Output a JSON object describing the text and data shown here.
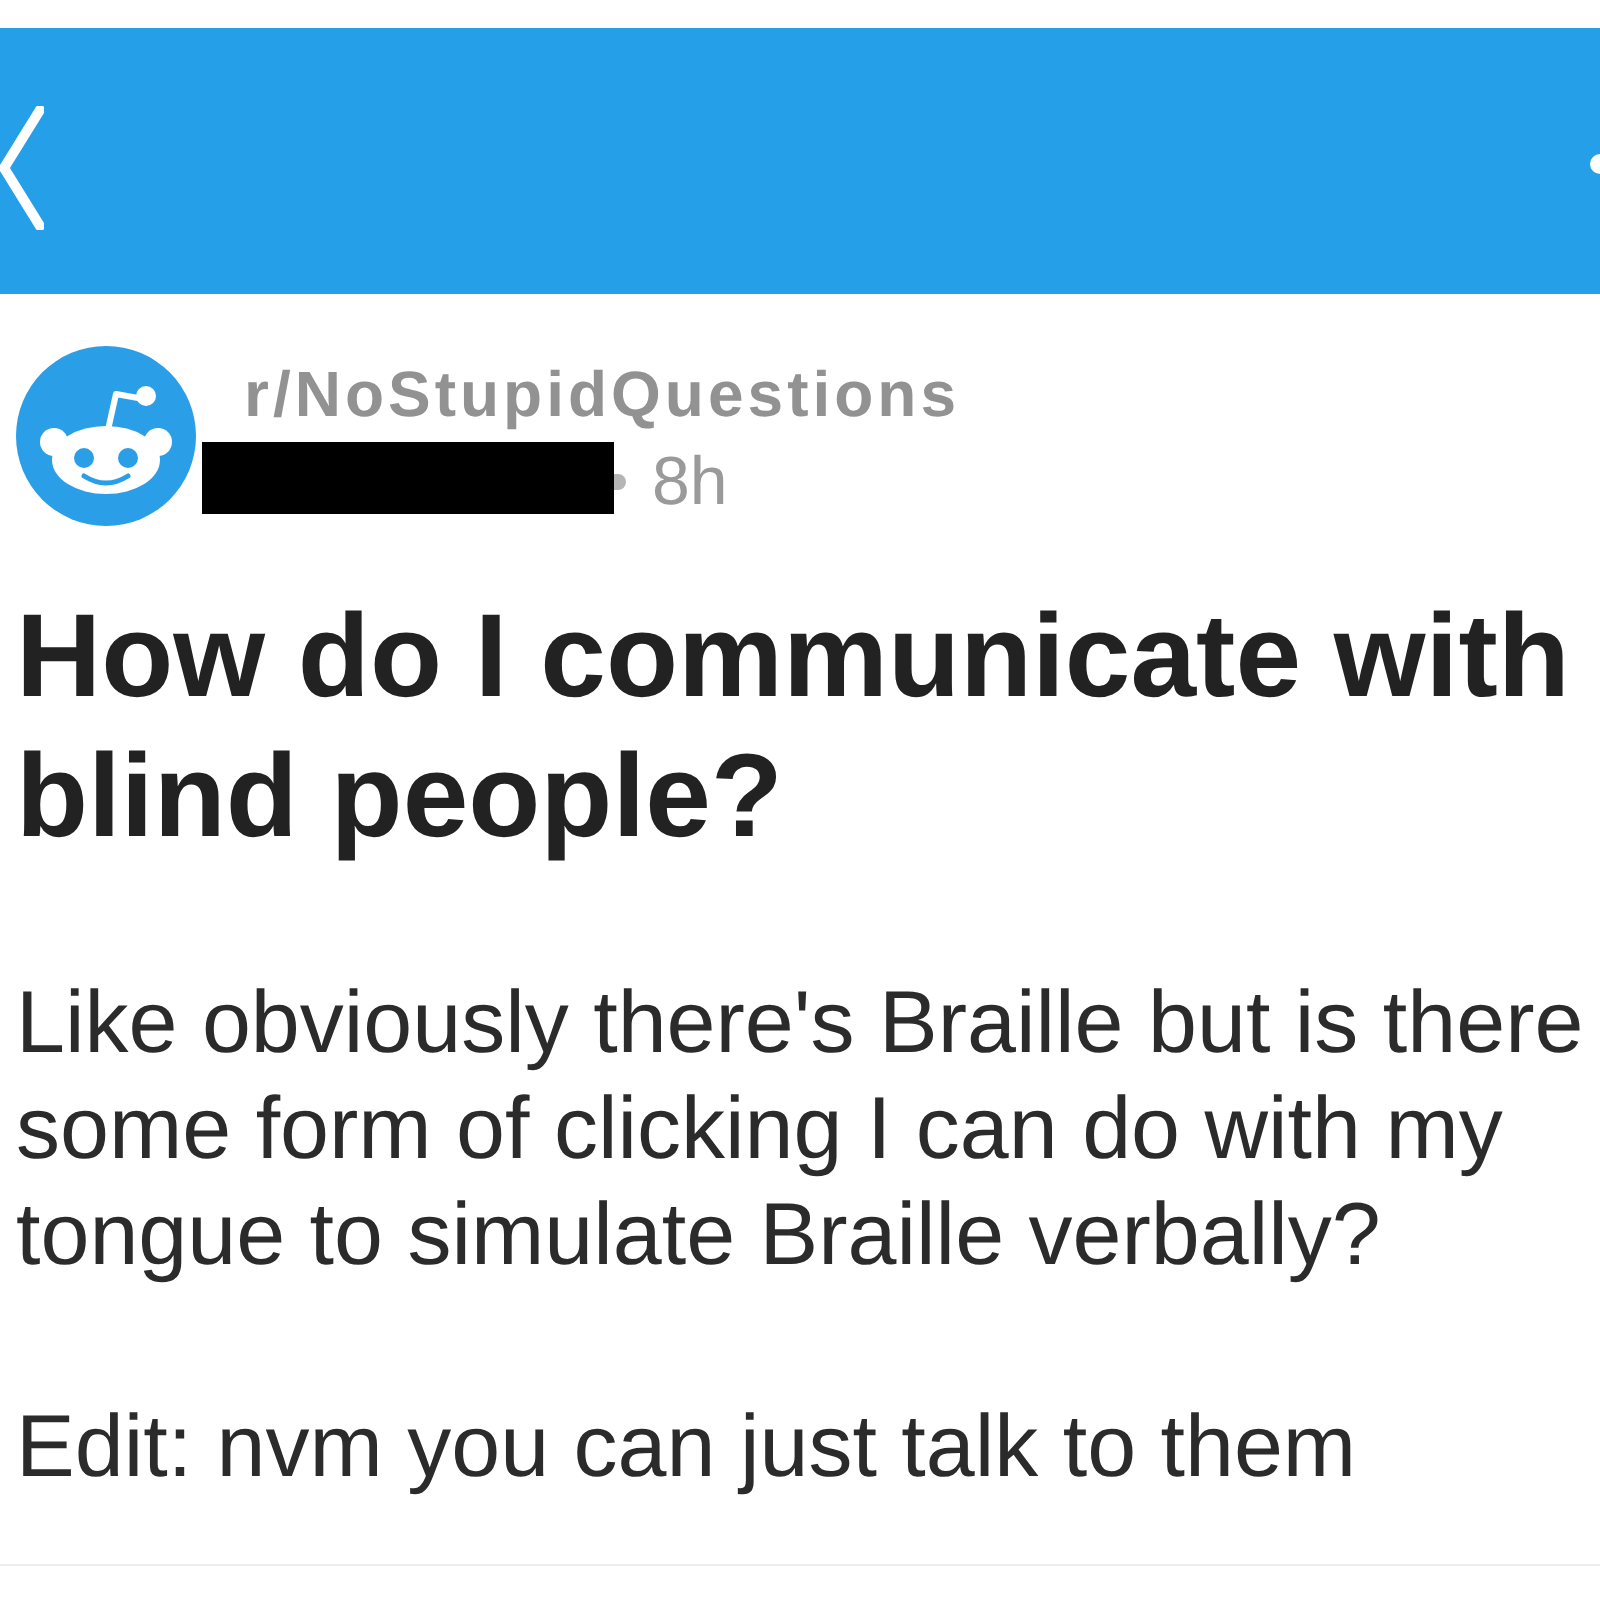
{
  "post": {
    "subreddit": "r/NoStupidQuestions",
    "author_redacted": true,
    "age": "8h",
    "title": "How do I communicate with blind people?",
    "body": [
      "Like obviously there's Braille but is there some form of clicking I can do with my tongue to simulate Braille verbally?",
      "Edit: nvm you can just talk to them"
    ]
  }
}
